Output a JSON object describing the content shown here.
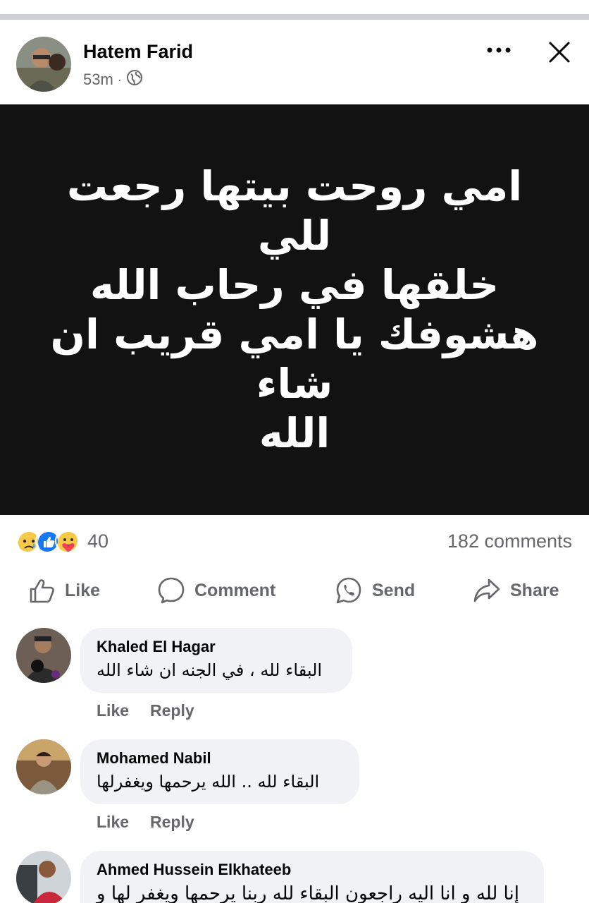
{
  "post": {
    "author": "Hatem Farid",
    "time": "53m",
    "visibility_icon": "globe-icon",
    "image_text_lines": [
      "امي روحت بيتها رجعت للي",
      "خلقها في رحاب الله",
      "هشوفك يا امي قريب ان شاء",
      "الله"
    ]
  },
  "reactions": {
    "icons": [
      "sad-reaction-icon",
      "like-reaction-icon",
      "care-reaction-icon"
    ],
    "count": "40",
    "comments": "182 comments"
  },
  "actions": {
    "like": "Like",
    "comment": "Comment",
    "send": "Send",
    "share": "Share"
  },
  "comments": [
    {
      "author": "Khaled El Hagar",
      "text": "البقاء لله ، في الجنه ان شاء الله",
      "like": "Like",
      "reply": "Reply"
    },
    {
      "author": "Mohamed Nabil",
      "text": "البقاء لله .. الله يرحمها ويغفرلها",
      "like": "Like",
      "reply": "Reply"
    },
    {
      "author": "Ahmed Hussein Elkhateeb",
      "text": "إنا لله و انا اليه راجعون البقاء لله ربنا يرحمها ويغفر لها و"
    }
  ],
  "colors": {
    "divider": "#ced0d4",
    "image_bg": "#121212",
    "bubble": "#f0f2f5",
    "secondary_text": "#65676b",
    "like_blue": "#1877f2"
  }
}
